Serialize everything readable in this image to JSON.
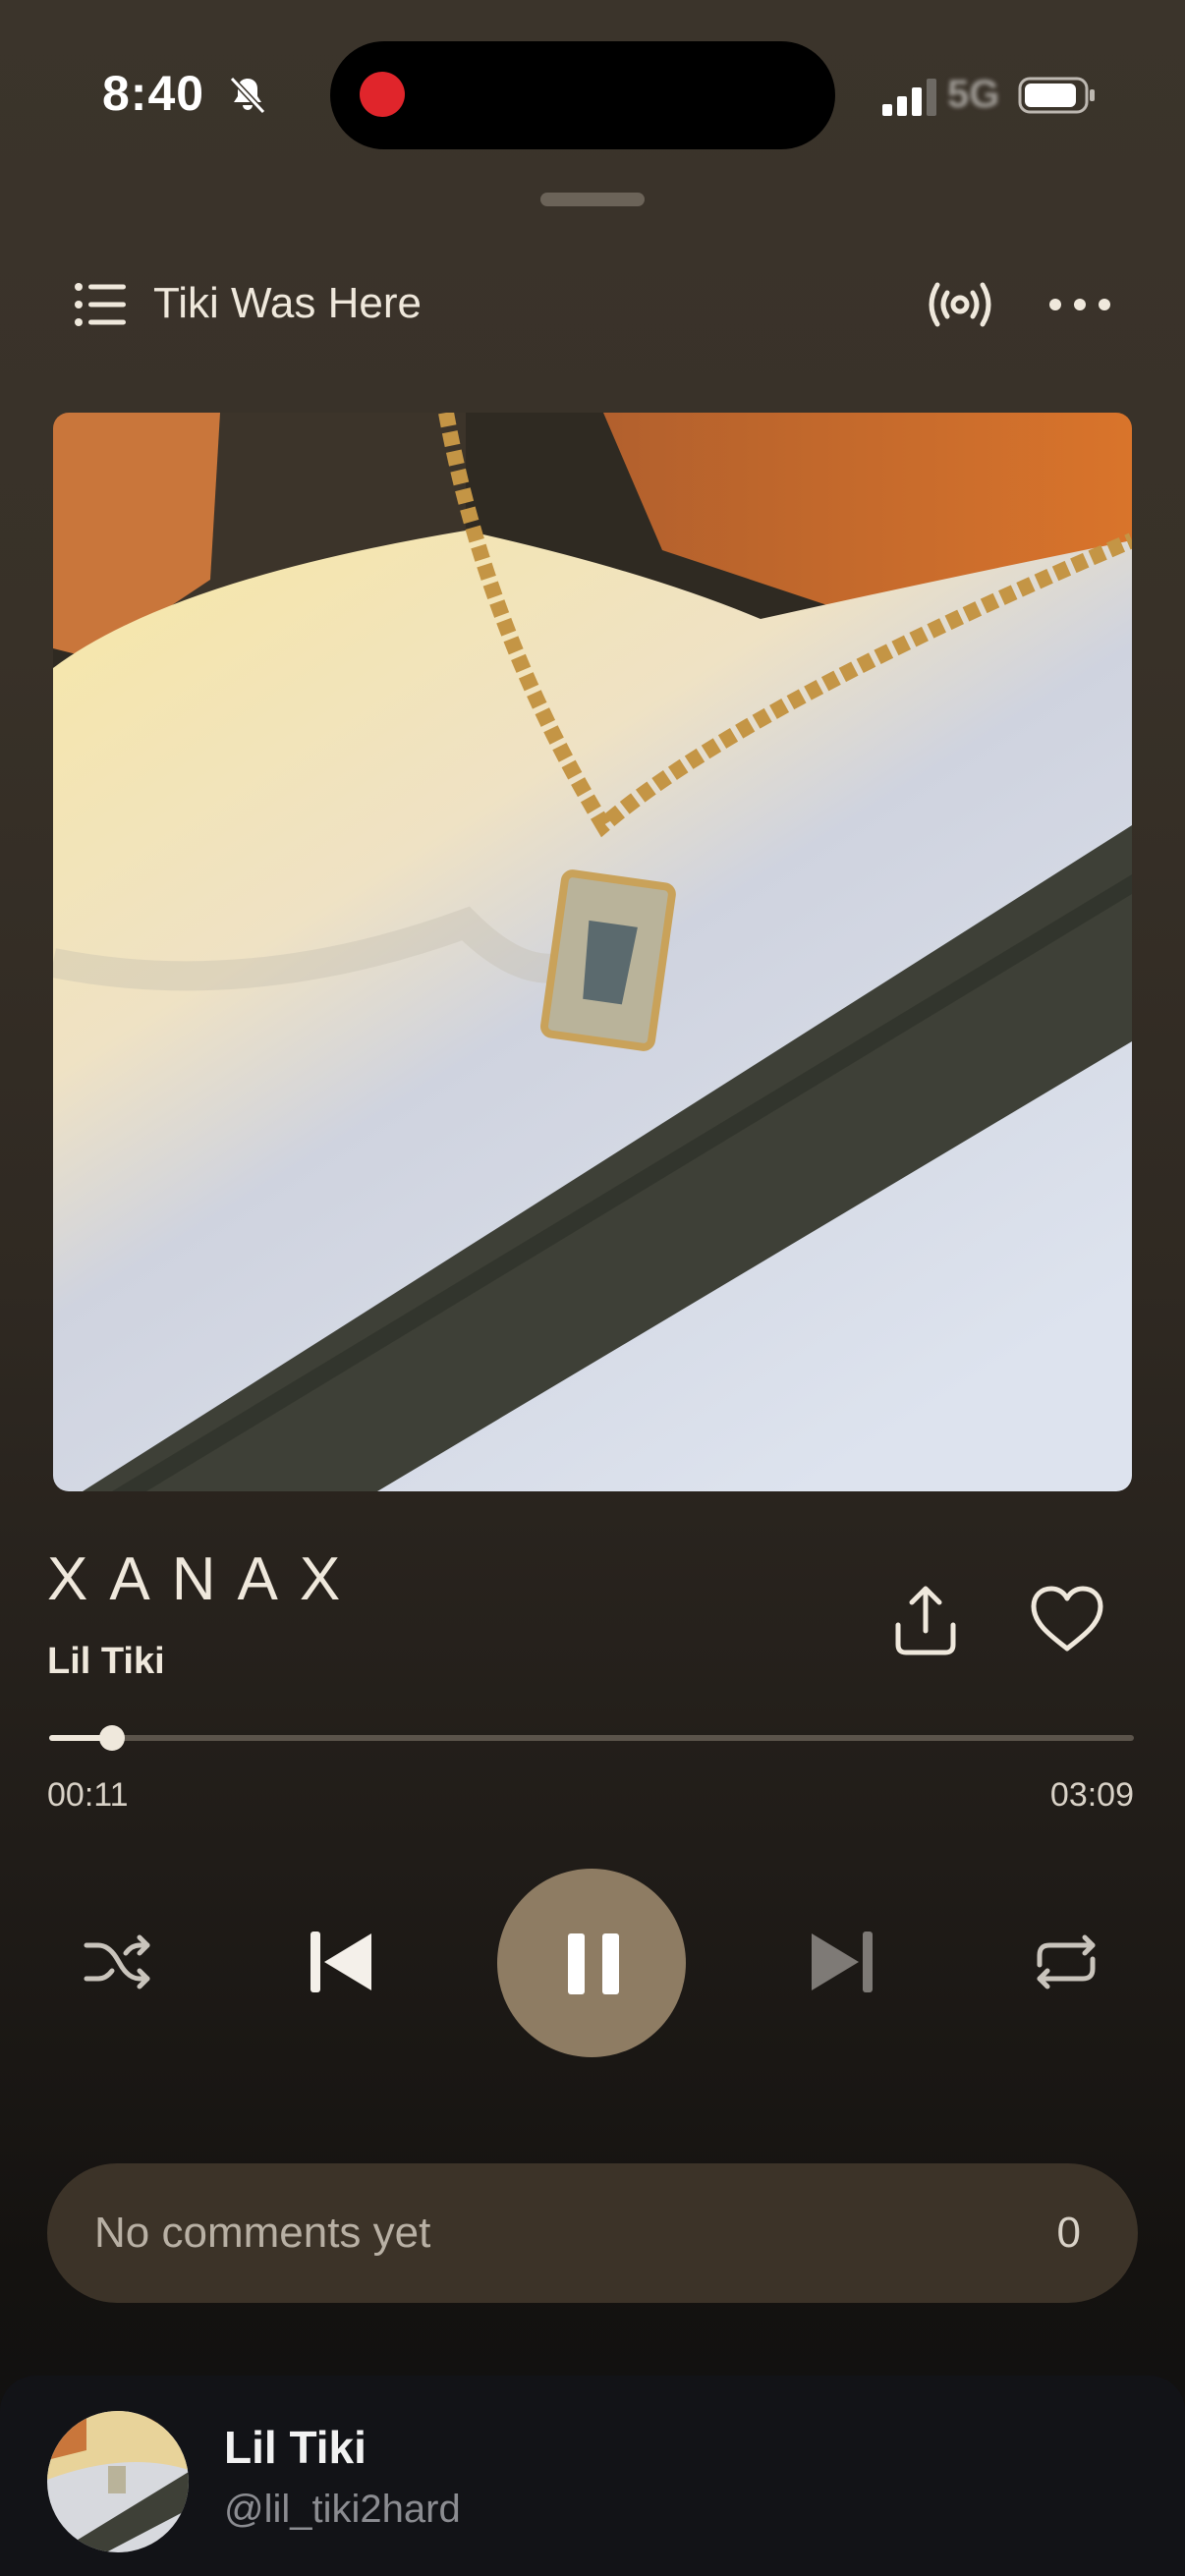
{
  "status_bar": {
    "time": "8:40",
    "network": "5G",
    "recording": true,
    "icons": [
      "bell-slash-icon",
      "signal-icon",
      "battery-icon"
    ]
  },
  "header": {
    "playlist_title": "Tiki Was Here",
    "icons": [
      "list-icon",
      "broadcast-icon",
      "more-icon"
    ]
  },
  "track": {
    "title": "XANAX",
    "artist": "Lil Tiki",
    "elapsed": "00:11",
    "duration": "03:09",
    "progress": 0.058,
    "is_playing": true,
    "liked": false
  },
  "controls": {
    "icons": [
      "shuffle-icon",
      "previous-icon",
      "pause-icon",
      "next-icon",
      "repeat-icon"
    ],
    "next_disabled": true
  },
  "comments": {
    "text": "No comments yet",
    "count": "0"
  },
  "owner": {
    "name": "Lil Tiki",
    "handle": "@lil_tiki2hard"
  },
  "colors": {
    "accent": "#8e7c63",
    "comment_bar": "#3c3328",
    "record_dot": "#e0252b",
    "sheet_bg": "#121317"
  }
}
